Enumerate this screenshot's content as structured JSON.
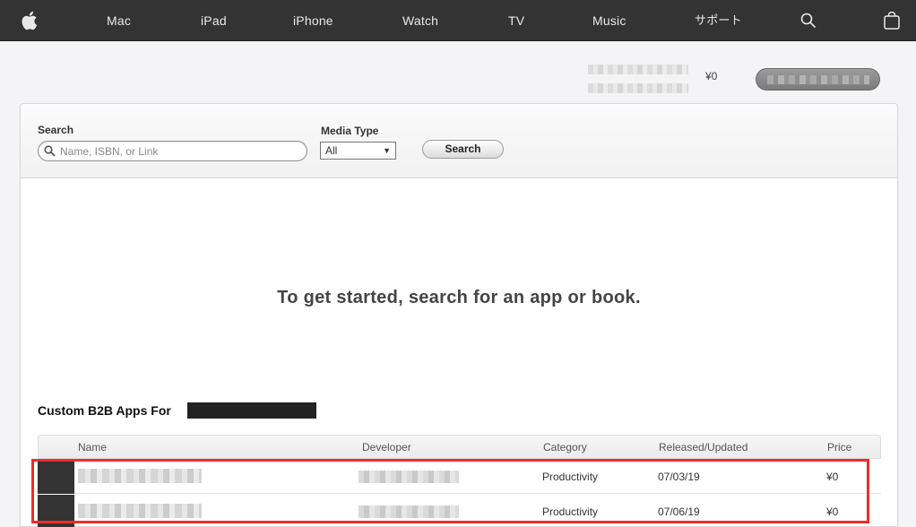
{
  "nav": {
    "items": [
      {
        "label": "Mac"
      },
      {
        "label": "iPad"
      },
      {
        "label": "iPhone"
      },
      {
        "label": "Watch"
      },
      {
        "label": "TV"
      },
      {
        "label": "Music"
      },
      {
        "label": "サポート"
      }
    ],
    "icons": [
      "apple-logo-icon",
      "search-icon",
      "bag-icon"
    ]
  },
  "account": {
    "balance": "¥0"
  },
  "search": {
    "label": "Search",
    "placeholder": "Name, ISBN, or Link",
    "media_type_label": "Media Type",
    "media_type_value": "All",
    "button_label": "Search"
  },
  "main": {
    "prompt": "To get started, search for an app or book."
  },
  "b2b": {
    "title": "Custom B2B Apps For",
    "columns": [
      "Name",
      "Developer",
      "Category",
      "Released/Updated",
      "Price"
    ],
    "rows": [
      {
        "category": "Productivity",
        "released": "07/03/19",
        "price": "¥0"
      },
      {
        "category": "Productivity",
        "released": "07/06/19",
        "price": "¥0"
      }
    ]
  },
  "colors": {
    "nav_bg": "#333333",
    "highlight": "#ee2d2d"
  }
}
